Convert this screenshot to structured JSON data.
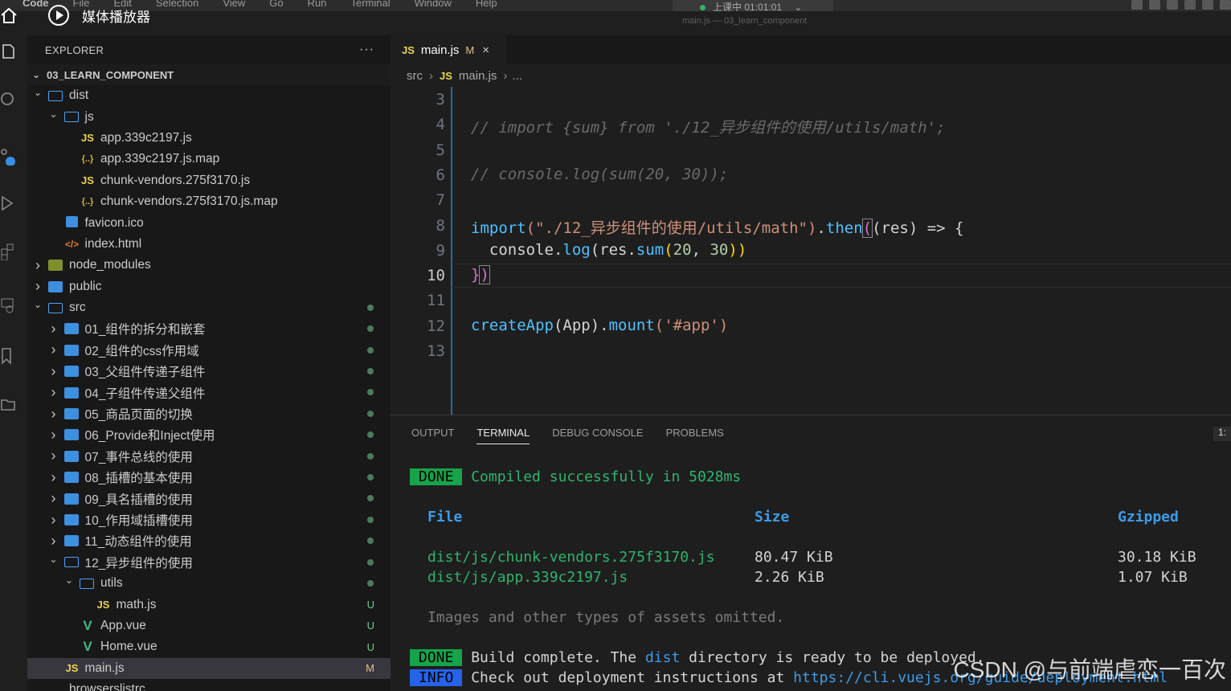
{
  "menubar": {
    "items": [
      "Code",
      "File",
      "Edit",
      "Selection",
      "View",
      "Go",
      "Run",
      "Terminal",
      "Window",
      "Help"
    ],
    "recording": "上课中 01:01:01",
    "window_subtitle": "main.js — 03_learn_component"
  },
  "overlay": {
    "title": "媒体播放器"
  },
  "sidebar": {
    "header": "EXPLORER",
    "more": "···",
    "section": "03_LEARN_COMPONENT",
    "tree": [
      {
        "label": "dist",
        "indent": 1,
        "chev": "v",
        "icon": "folder-open"
      },
      {
        "label": "js",
        "indent": 2,
        "chev": "v",
        "icon": "folder-open"
      },
      {
        "label": "app.339c2197.js",
        "indent": 3,
        "icon": "js"
      },
      {
        "label": "app.339c2197.js.map",
        "indent": 3,
        "icon": "map"
      },
      {
        "label": "chunk-vendors.275f3170.js",
        "indent": 3,
        "icon": "js"
      },
      {
        "label": "chunk-vendors.275f3170.js.map",
        "indent": 3,
        "icon": "map"
      },
      {
        "label": "favicon.ico",
        "indent": 2,
        "icon": "ico"
      },
      {
        "label": "index.html",
        "indent": 2,
        "icon": "html"
      },
      {
        "label": "node_modules",
        "indent": 1,
        "chev": ">",
        "icon": "folder-nm"
      },
      {
        "label": "public",
        "indent": 1,
        "chev": ">",
        "icon": "folder"
      },
      {
        "label": "src",
        "indent": 1,
        "chev": "v",
        "icon": "folder-open",
        "badge": "dot"
      },
      {
        "label": "01_组件的拆分和嵌套",
        "indent": 2,
        "chev": ">",
        "icon": "folder",
        "badge": "dot"
      },
      {
        "label": "02_组件的css作用域",
        "indent": 2,
        "chev": ">",
        "icon": "folder",
        "badge": "dot"
      },
      {
        "label": "03_父组件传递子组件",
        "indent": 2,
        "chev": ">",
        "icon": "folder",
        "badge": "dot"
      },
      {
        "label": "04_子组件传递父组件",
        "indent": 2,
        "chev": ">",
        "icon": "folder",
        "badge": "dot"
      },
      {
        "label": "05_商品页面的切换",
        "indent": 2,
        "chev": ">",
        "icon": "folder",
        "badge": "dot"
      },
      {
        "label": "06_Provide和Inject使用",
        "indent": 2,
        "chev": ">",
        "icon": "folder",
        "badge": "dot"
      },
      {
        "label": "07_事件总线的使用",
        "indent": 2,
        "chev": ">",
        "icon": "folder",
        "badge": "dot"
      },
      {
        "label": "08_插槽的基本使用",
        "indent": 2,
        "chev": ">",
        "icon": "folder",
        "badge": "dot"
      },
      {
        "label": "09_具名插槽的使用",
        "indent": 2,
        "chev": ">",
        "icon": "folder",
        "badge": "dot"
      },
      {
        "label": "10_作用域插槽使用",
        "indent": 2,
        "chev": ">",
        "icon": "folder",
        "badge": "dot"
      },
      {
        "label": "11_动态组件的使用",
        "indent": 2,
        "chev": ">",
        "icon": "folder",
        "badge": "dot"
      },
      {
        "label": "12_异步组件的使用",
        "indent": 2,
        "chev": "v",
        "icon": "folder-open",
        "badge": "dot"
      },
      {
        "label": "utils",
        "indent": 3,
        "chev": "v",
        "icon": "folder-open",
        "badge": "dot"
      },
      {
        "label": "math.js",
        "indent": 4,
        "icon": "js",
        "badge": "U"
      },
      {
        "label": "App.vue",
        "indent": 3,
        "icon": "vue",
        "badge": "U"
      },
      {
        "label": "Home.vue",
        "indent": 3,
        "icon": "vue",
        "badge": "U"
      },
      {
        "label": "main.js",
        "indent": 2,
        "icon": "js",
        "badge": "M",
        "active": true
      },
      {
        "label": "browserslistrc",
        "indent": 1,
        "icon": "file"
      }
    ]
  },
  "editor": {
    "tab": {
      "icon": "JS",
      "label": "main.js",
      "modified": "M",
      "close": "×"
    },
    "breadcrumbs": [
      "src",
      "main.js",
      "..."
    ],
    "line_numbers": [
      "3",
      "4",
      "5",
      "6",
      "7",
      "8",
      "9",
      "10",
      "11",
      "12",
      "13"
    ],
    "current_line": "10",
    "lines": {
      "l4": "// import {sum} from './12_异步组件的使用/utils/math';",
      "l6": "// console.log(sum(20, 30));",
      "l8_a": "import",
      "l8_b": "(\"./12_异步组件的使用/utils/math\")",
      "l8_c": ".",
      "l8_d": "then",
      "l8_e": "(",
      "l8_f": "(res) => {",
      "l9_a": "  console.",
      "l9_b": "log",
      "l9_c": "(res.",
      "l9_d": "sum",
      "l9_e": "(",
      "l9_f": "20",
      "l9_g": ", ",
      "l9_h": "30",
      "l9_i": "))",
      "l10_a": "}",
      "l10_b": ")",
      "l12_a": "createApp",
      "l12_b": "(App).",
      "l12_c": "mount",
      "l12_d": "('#app')"
    }
  },
  "panel": {
    "tabs": [
      "OUTPUT",
      "TERMINAL",
      "DEBUG CONSOLE",
      "PROBLEMS"
    ],
    "active_tab": "TERMINAL",
    "number": "1:",
    "terminal": {
      "done1": "DONE",
      "compiled": "Compiled successfully in 5028ms",
      "headers": [
        "File",
        "Size",
        "Gzipped"
      ],
      "rows": [
        [
          "dist/js/chunk-vendors.275f3170.js",
          "80.47 KiB",
          "30.18 KiB"
        ],
        [
          "dist/js/app.339c2197.js",
          "2.26 KiB",
          "1.07 KiB"
        ]
      ],
      "omitted": "Images and other types of assets omitted.",
      "done2": "DONE",
      "build_a": "Build complete. The ",
      "build_b": "dist",
      "build_c": " directory is ready to be deployed.",
      "info": "INFO",
      "check_a": "Check out deployment instructions at ",
      "check_b": "https://cli.vuejs.org/guide/deployment.html"
    }
  },
  "watermark": "CSDN @与前端虐恋一百次",
  "colors": {
    "accent": "#2f7cc4",
    "modified": "#e2c08d",
    "untracked": "#73c991",
    "done": "#16a34a",
    "info": "#2563eb"
  }
}
